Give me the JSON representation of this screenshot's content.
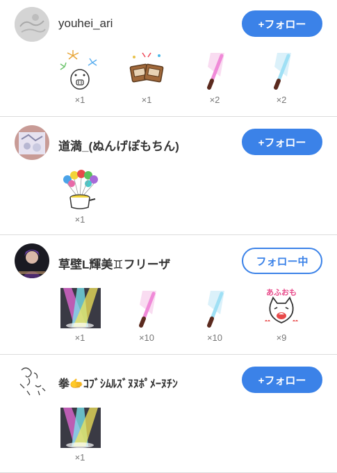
{
  "users": [
    {
      "name": "youhei_ari",
      "button": "+フォロー",
      "gifts": [
        {
          "icon": "fireworks-pig-icon",
          "count": "×1"
        },
        {
          "icon": "accordion-cheers-icon",
          "count": "×1"
        },
        {
          "icon": "pink-penlight-icon",
          "count": "×2"
        },
        {
          "icon": "blue-penlight-icon",
          "count": "×2"
        }
      ]
    },
    {
      "name": "道満_(ぬんげぽもちん)",
      "button": "+フォロー",
      "gifts": [
        {
          "icon": "balloons-pot-icon",
          "count": "×1"
        }
      ]
    },
    {
      "name": "草壁L輝美♊フリーザ",
      "button": "フォロー中",
      "gifts": [
        {
          "icon": "stage-spotlight-icon",
          "count": "×1"
        },
        {
          "icon": "pink-penlight-icon",
          "count": "×10"
        },
        {
          "icon": "blue-penlight-icon",
          "count": "×10"
        },
        {
          "icon": "afuomo-cat-icon",
          "count": "×9",
          "label": "あふおも"
        }
      ]
    },
    {
      "name": "拳🫱ｺﾌﾞｼﾑﾙｽﾞﾇﾇﾎﾟﾒｰﾇﾁﾝ",
      "button": "+フォロー",
      "gifts": [
        {
          "icon": "stage-spotlight-icon",
          "count": "×1"
        }
      ]
    }
  ],
  "colors": {
    "accent": "#3b82e8",
    "divider": "#dcdcdc",
    "count_text": "#777777"
  }
}
